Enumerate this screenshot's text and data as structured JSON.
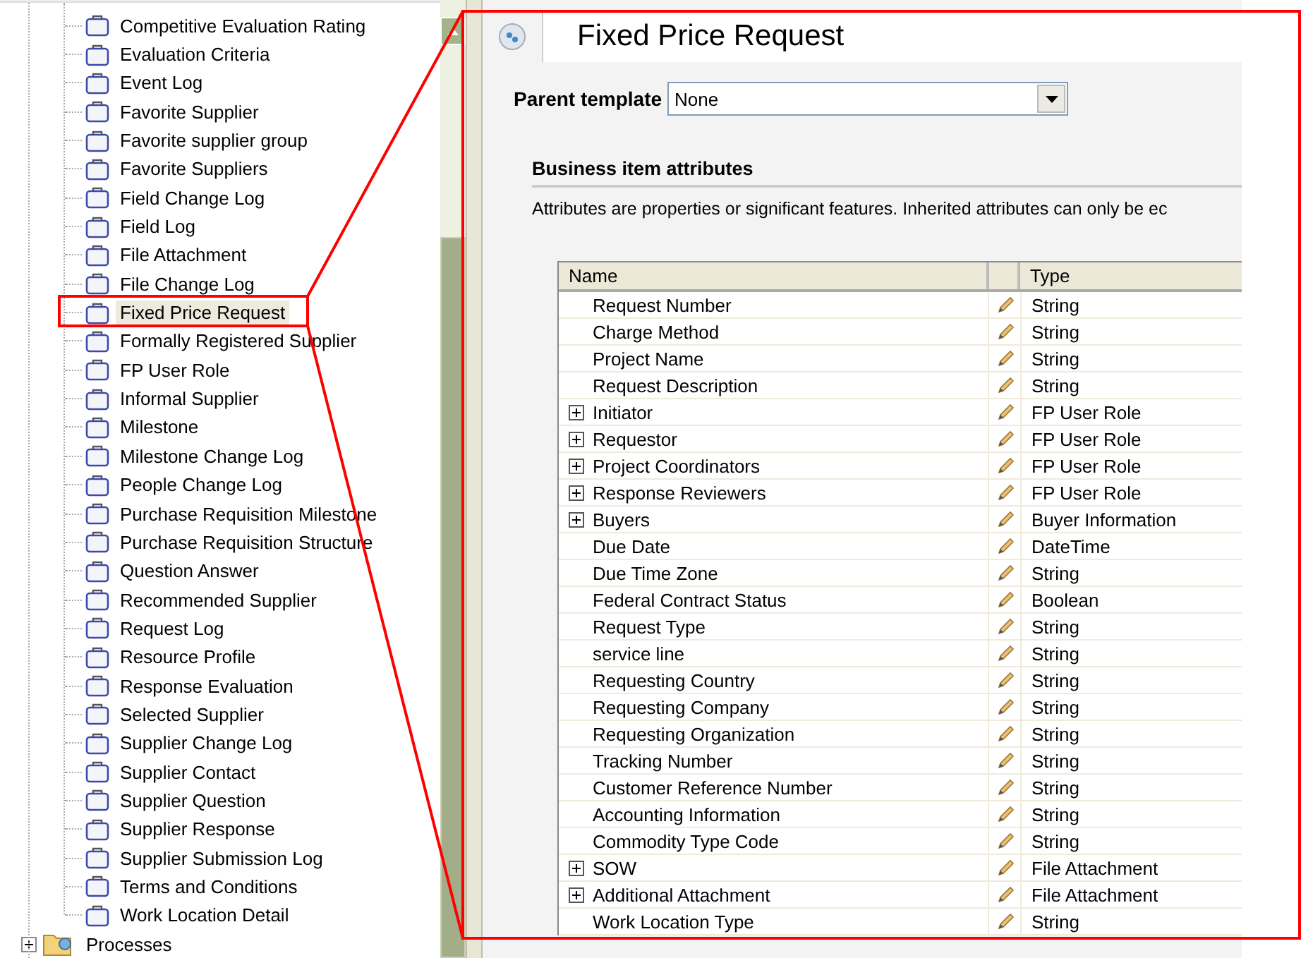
{
  "tree": {
    "items": [
      {
        "label": "Competitive Evaluation Rating",
        "selected": false
      },
      {
        "label": "Evaluation Criteria",
        "selected": false
      },
      {
        "label": "Event Log",
        "selected": false
      },
      {
        "label": "Favorite Supplier",
        "selected": false
      },
      {
        "label": "Favorite supplier group",
        "selected": false
      },
      {
        "label": "Favorite Suppliers",
        "selected": false
      },
      {
        "label": "Field Change Log",
        "selected": false
      },
      {
        "label": "Field Log",
        "selected": false
      },
      {
        "label": "File Attachment",
        "selected": false
      },
      {
        "label": "File Change Log",
        "selected": false
      },
      {
        "label": "Fixed Price Request",
        "selected": true
      },
      {
        "label": "Formally Registered Supplier",
        "selected": false
      },
      {
        "label": "FP User Role",
        "selected": false
      },
      {
        "label": "Informal Supplier",
        "selected": false
      },
      {
        "label": "Milestone",
        "selected": false
      },
      {
        "label": "Milestone Change Log",
        "selected": false
      },
      {
        "label": "People Change Log",
        "selected": false
      },
      {
        "label": "Purchase Requisition Milestone",
        "selected": false
      },
      {
        "label": "Purchase Requisition Structure",
        "selected": false
      },
      {
        "label": "Question Answer",
        "selected": false
      },
      {
        "label": "Recommended Supplier",
        "selected": false
      },
      {
        "label": "Request Log",
        "selected": false
      },
      {
        "label": "Resource Profile",
        "selected": false
      },
      {
        "label": "Response Evaluation",
        "selected": false
      },
      {
        "label": "Selected Supplier",
        "selected": false
      },
      {
        "label": "Supplier Change Log",
        "selected": false
      },
      {
        "label": "Supplier Contact",
        "selected": false
      },
      {
        "label": "Supplier Question",
        "selected": false
      },
      {
        "label": "Supplier Response",
        "selected": false
      },
      {
        "label": "Supplier Submission Log",
        "selected": false
      },
      {
        "label": "Terms and Conditions",
        "selected": false
      },
      {
        "label": "Work Location Detail",
        "selected": false
      }
    ],
    "folder": {
      "label": "Processes",
      "expanded": false
    }
  },
  "editor": {
    "title": "Fixed Price Request",
    "parent_template": {
      "label": "Parent template",
      "value": "None"
    },
    "section": {
      "title": "Business item attributes",
      "description": "Attributes are properties or significant features. Inherited attributes can only be ec"
    },
    "table": {
      "columns": [
        "Name",
        "Type"
      ],
      "rows": [
        {
          "name": "Request Number",
          "type": "String",
          "expandable": false
        },
        {
          "name": "Charge Method",
          "type": "String",
          "expandable": false
        },
        {
          "name": "Project Name",
          "type": "String",
          "expandable": false
        },
        {
          "name": "Request Description",
          "type": "String",
          "expandable": false
        },
        {
          "name": "Initiator",
          "type": "FP User Role",
          "expandable": true
        },
        {
          "name": "Requestor",
          "type": "FP User Role",
          "expandable": true
        },
        {
          "name": "Project Coordinators",
          "type": "FP User Role",
          "expandable": true
        },
        {
          "name": "Response Reviewers",
          "type": "FP User Role",
          "expandable": true
        },
        {
          "name": "Buyers",
          "type": "Buyer Information",
          "expandable": true
        },
        {
          "name": "Due Date",
          "type": "DateTime",
          "expandable": false
        },
        {
          "name": "Due Time Zone",
          "type": "String",
          "expandable": false
        },
        {
          "name": "Federal Contract Status",
          "type": "Boolean",
          "expandable": false
        },
        {
          "name": "Request Type",
          "type": "String",
          "expandable": false
        },
        {
          "name": "service line",
          "type": "String",
          "expandable": false
        },
        {
          "name": "Requesting Country",
          "type": "String",
          "expandable": false
        },
        {
          "name": "Requesting Company",
          "type": "String",
          "expandable": false
        },
        {
          "name": "Requesting Organization",
          "type": "String",
          "expandable": false
        },
        {
          "name": "Tracking Number",
          "type": "String",
          "expandable": false
        },
        {
          "name": "Customer Reference Number",
          "type": "String",
          "expandable": false
        },
        {
          "name": "Accounting Information",
          "type": "String",
          "expandable": false
        },
        {
          "name": "Commodity Type Code",
          "type": "String",
          "expandable": false
        },
        {
          "name": "SOW",
          "type": "File Attachment",
          "expandable": true
        },
        {
          "name": "Additional Attachment",
          "type": "File Attachment",
          "expandable": true
        },
        {
          "name": "Work Location Type",
          "type": "String",
          "expandable": false
        }
      ]
    }
  }
}
